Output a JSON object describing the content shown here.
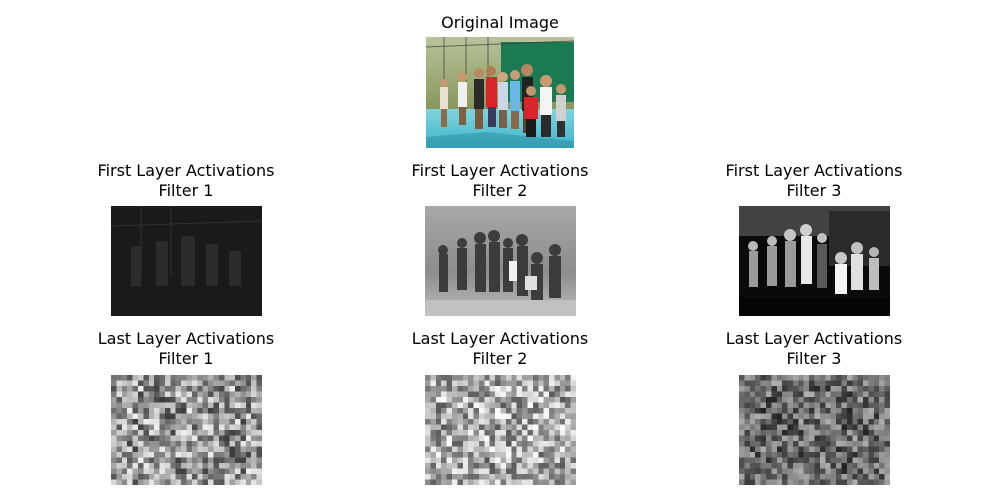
{
  "original": {
    "title": "Original Image",
    "alt": "Group of children standing on a blue tennis court in front of a fence and trees"
  },
  "first_layer": [
    {
      "title_line1": "First Layer Activations",
      "title_line2": "Filter 1"
    },
    {
      "title_line1": "First Layer Activations",
      "title_line2": "Filter 2"
    },
    {
      "title_line1": "First Layer Activations",
      "title_line2": "Filter 3"
    }
  ],
  "last_layer": [
    {
      "title_line1": "Last Layer Activations",
      "title_line2": "Filter 1"
    },
    {
      "title_line1": "Last Layer Activations",
      "title_line2": "Filter 2"
    },
    {
      "title_line1": "Last Layer Activations",
      "title_line2": "Filter 3"
    }
  ],
  "colors": {
    "court_blue": "#5cc6d6",
    "fence_green": "#1c7a52",
    "foliage": "#7a8a3a",
    "shirt_red": "#d8242a",
    "dark_bg": "#1a1a1a",
    "white": "#ffffff"
  }
}
